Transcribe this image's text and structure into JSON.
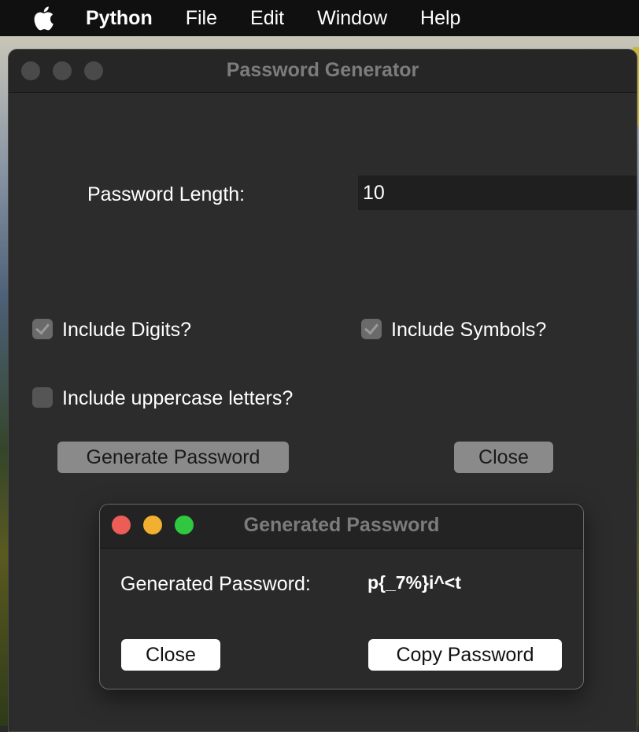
{
  "menubar": {
    "app_name": "Python",
    "items": [
      "File",
      "Edit",
      "Window",
      "Help"
    ]
  },
  "main_window": {
    "title": "Password Generator",
    "length_label": "Password Length:",
    "length_value": "10",
    "digits_label": "Include Digits?",
    "digits_checked": true,
    "symbols_label": "Include Symbols?",
    "symbols_checked": true,
    "uppercase_label": "Include uppercase letters?",
    "uppercase_checked": false,
    "generate_label": "Generate Password",
    "close_label": "Close"
  },
  "dialog": {
    "title": "Generated Password",
    "password_label": "Generated Password:",
    "password_value": "p{_7%}i^<t",
    "close_label": "Close",
    "copy_label": "Copy Password"
  },
  "colors": {
    "menubar_bg": "#101010",
    "window_bg": "#2c2c2c",
    "close_light": "#ec5d57",
    "minimize_light": "#f1b02f",
    "maximize_light": "#2fc840"
  }
}
